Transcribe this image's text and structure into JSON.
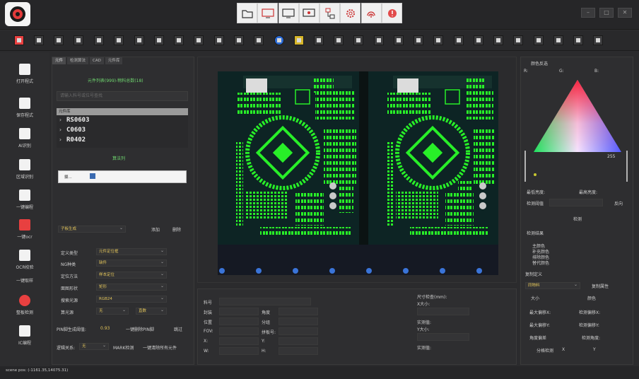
{
  "left_nav": [
    {
      "id": "open",
      "label": "打开程式"
    },
    {
      "id": "save",
      "label": "保存程式"
    },
    {
      "id": "ai",
      "label": "AI识别"
    },
    {
      "id": "region",
      "label": "区域识别"
    },
    {
      "id": "onekey",
      "label": "一键编程"
    },
    {
      "id": "ocr",
      "label": "一键ocr"
    },
    {
      "id": "ocrcheck",
      "label": "OCR校验"
    },
    {
      "id": "sample",
      "label": "一键取样"
    },
    {
      "id": "board",
      "label": "整板检测"
    },
    {
      "id": "ic",
      "label": "IC编程"
    }
  ],
  "left_panel": {
    "tabs": [
      "元件",
      "检测算法",
      "CAD",
      "元件库"
    ],
    "title": "元件列表(999)-物料总数(18)",
    "search_placeholder": "请输入料号或位号查找",
    "tree_header": "元件库",
    "tree_items": [
      "RS0603",
      "C0603",
      "R0402"
    ],
    "algo_title": "算法列",
    "algo_item": "摄...",
    "sub_board": "子板生成",
    "add": "添加",
    "delete": "删除",
    "props": [
      {
        "label": "定义类型",
        "value": "元件定位框"
      },
      {
        "label": "NG种类",
        "value": "缺件"
      },
      {
        "label": "定位方法",
        "value": "样本定位"
      },
      {
        "label": "面图形状",
        "value": "矩形"
      },
      {
        "label": "搜索光源",
        "value": "RGB24"
      },
      {
        "label": "算光源",
        "value": "无"
      }
    ],
    "extra_value": "直数",
    "pin_label": "PIN脚生成阈值:",
    "pin_value": "0.93",
    "pin_delete": "一键删除PIN脚",
    "skip": "跳过",
    "logic_label": "逻辑关系:",
    "logic_value": "无",
    "mark": "MARK检测",
    "clear_all": "一键清除所有元件"
  },
  "info_panel": {
    "labels": [
      "料号",
      "封装",
      "位置",
      "FOV:",
      "X:",
      "W:"
    ],
    "labels2": [
      "角度",
      "分组",
      "拼板号:",
      "Y:",
      "H:"
    ],
    "size_label": "尺寸检查(mm):",
    "x_size": "X大小:",
    "measure1": "实测值:",
    "y_size": "Y大小:",
    "measure2": "实测值:"
  },
  "right_panel": {
    "title": "颜色反选",
    "rgb": [
      "R:",
      "G:",
      "B:"
    ],
    "scale_max": "255",
    "min_bright": "最低亮度:",
    "max_bright": "最高亮度:",
    "threshold": "检测阈值",
    "reverse": "反向",
    "detect": "检测",
    "result_title": "检测结果",
    "result_items": [
      "主颜色",
      "补充颜色",
      "排除颜色",
      "替代颜色"
    ],
    "copy_title": "复制定义",
    "copy_value": "同物料",
    "copy_btn": "复制属性",
    "size_chk": "大小",
    "color_chk": "颜色",
    "max_dx": "最大偏移X:",
    "det_dx": "检测偏移X:",
    "max_dy": "最大偏移Y:",
    "det_dy": "检测偏移Y:",
    "angle_dev": "角度偏差",
    "det_angle": "检测角度:",
    "split": "分格检测",
    "x": "X",
    "y": "Y"
  },
  "status": "scene pos: (-1161.35,14075.31)"
}
